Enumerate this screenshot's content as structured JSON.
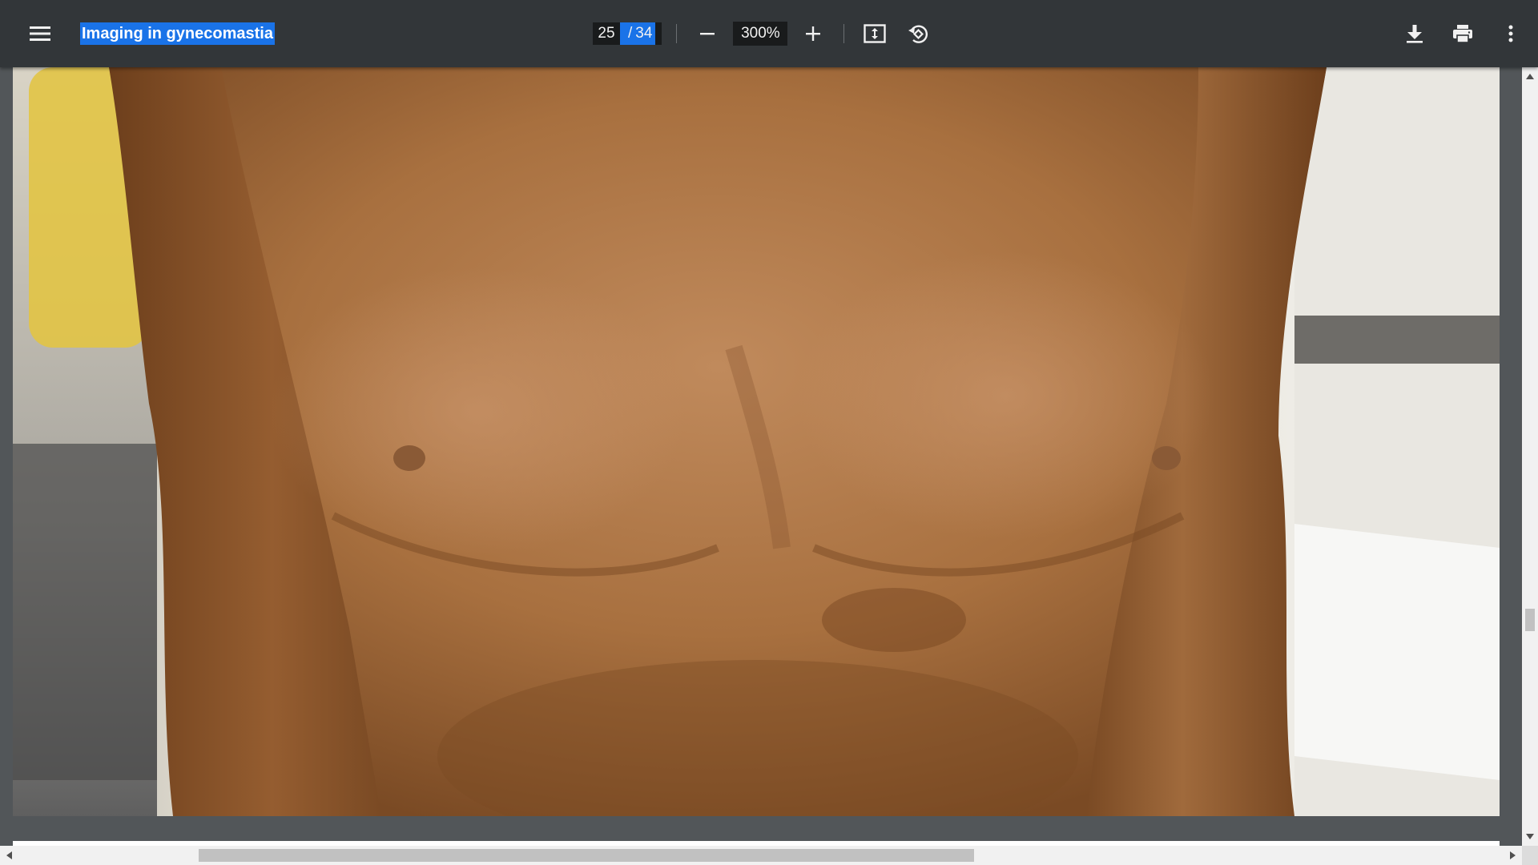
{
  "toolbar": {
    "title": "Imaging in gynecomastia",
    "current_page": "25",
    "page_separator": "/",
    "total_pages": "34",
    "zoom": "300%",
    "icons": {
      "menu": "menu-icon",
      "zoom_out": "minus-icon",
      "zoom_in": "plus-icon",
      "fit": "fit-to-page-icon",
      "rotate": "rotate-icon",
      "download": "download-icon",
      "print": "print-icon",
      "more": "more-vert-icon"
    },
    "bg_color": "#323639",
    "selection_color": "#1a73e8"
  },
  "viewer": {
    "background": "#525659",
    "page_content": "photo-male-chest"
  }
}
